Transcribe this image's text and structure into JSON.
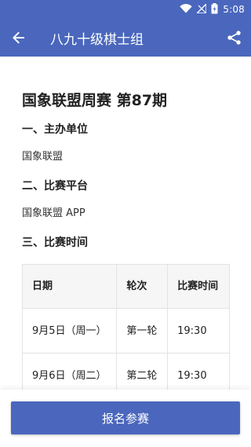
{
  "colors": {
    "primary": "#4a67bd",
    "text": "#222222"
  },
  "status_bar": {
    "time": "5:08",
    "icons": [
      "wifi-icon",
      "signal-icon",
      "battery-icon"
    ]
  },
  "app_bar": {
    "title": "八九十级棋士组",
    "back_icon": "arrow-back-icon",
    "share_icon": "share-icon"
  },
  "article": {
    "title": "国象联盟周赛 第87期",
    "sections": [
      {
        "heading": "一、主办单位",
        "body": "国象联盟"
      },
      {
        "heading": "二、比赛平台",
        "body": "国象联盟 APP"
      },
      {
        "heading": "三、比赛时间"
      }
    ],
    "table": {
      "headers": [
        "日期",
        "轮次",
        "比赛时间"
      ],
      "rows": [
        [
          "9月5日（周一）",
          "第一轮",
          "19:30"
        ],
        [
          "9月6日（周二）",
          "第二轮",
          "19:30"
        ]
      ]
    }
  },
  "footer": {
    "signup_label": "报名参赛"
  }
}
